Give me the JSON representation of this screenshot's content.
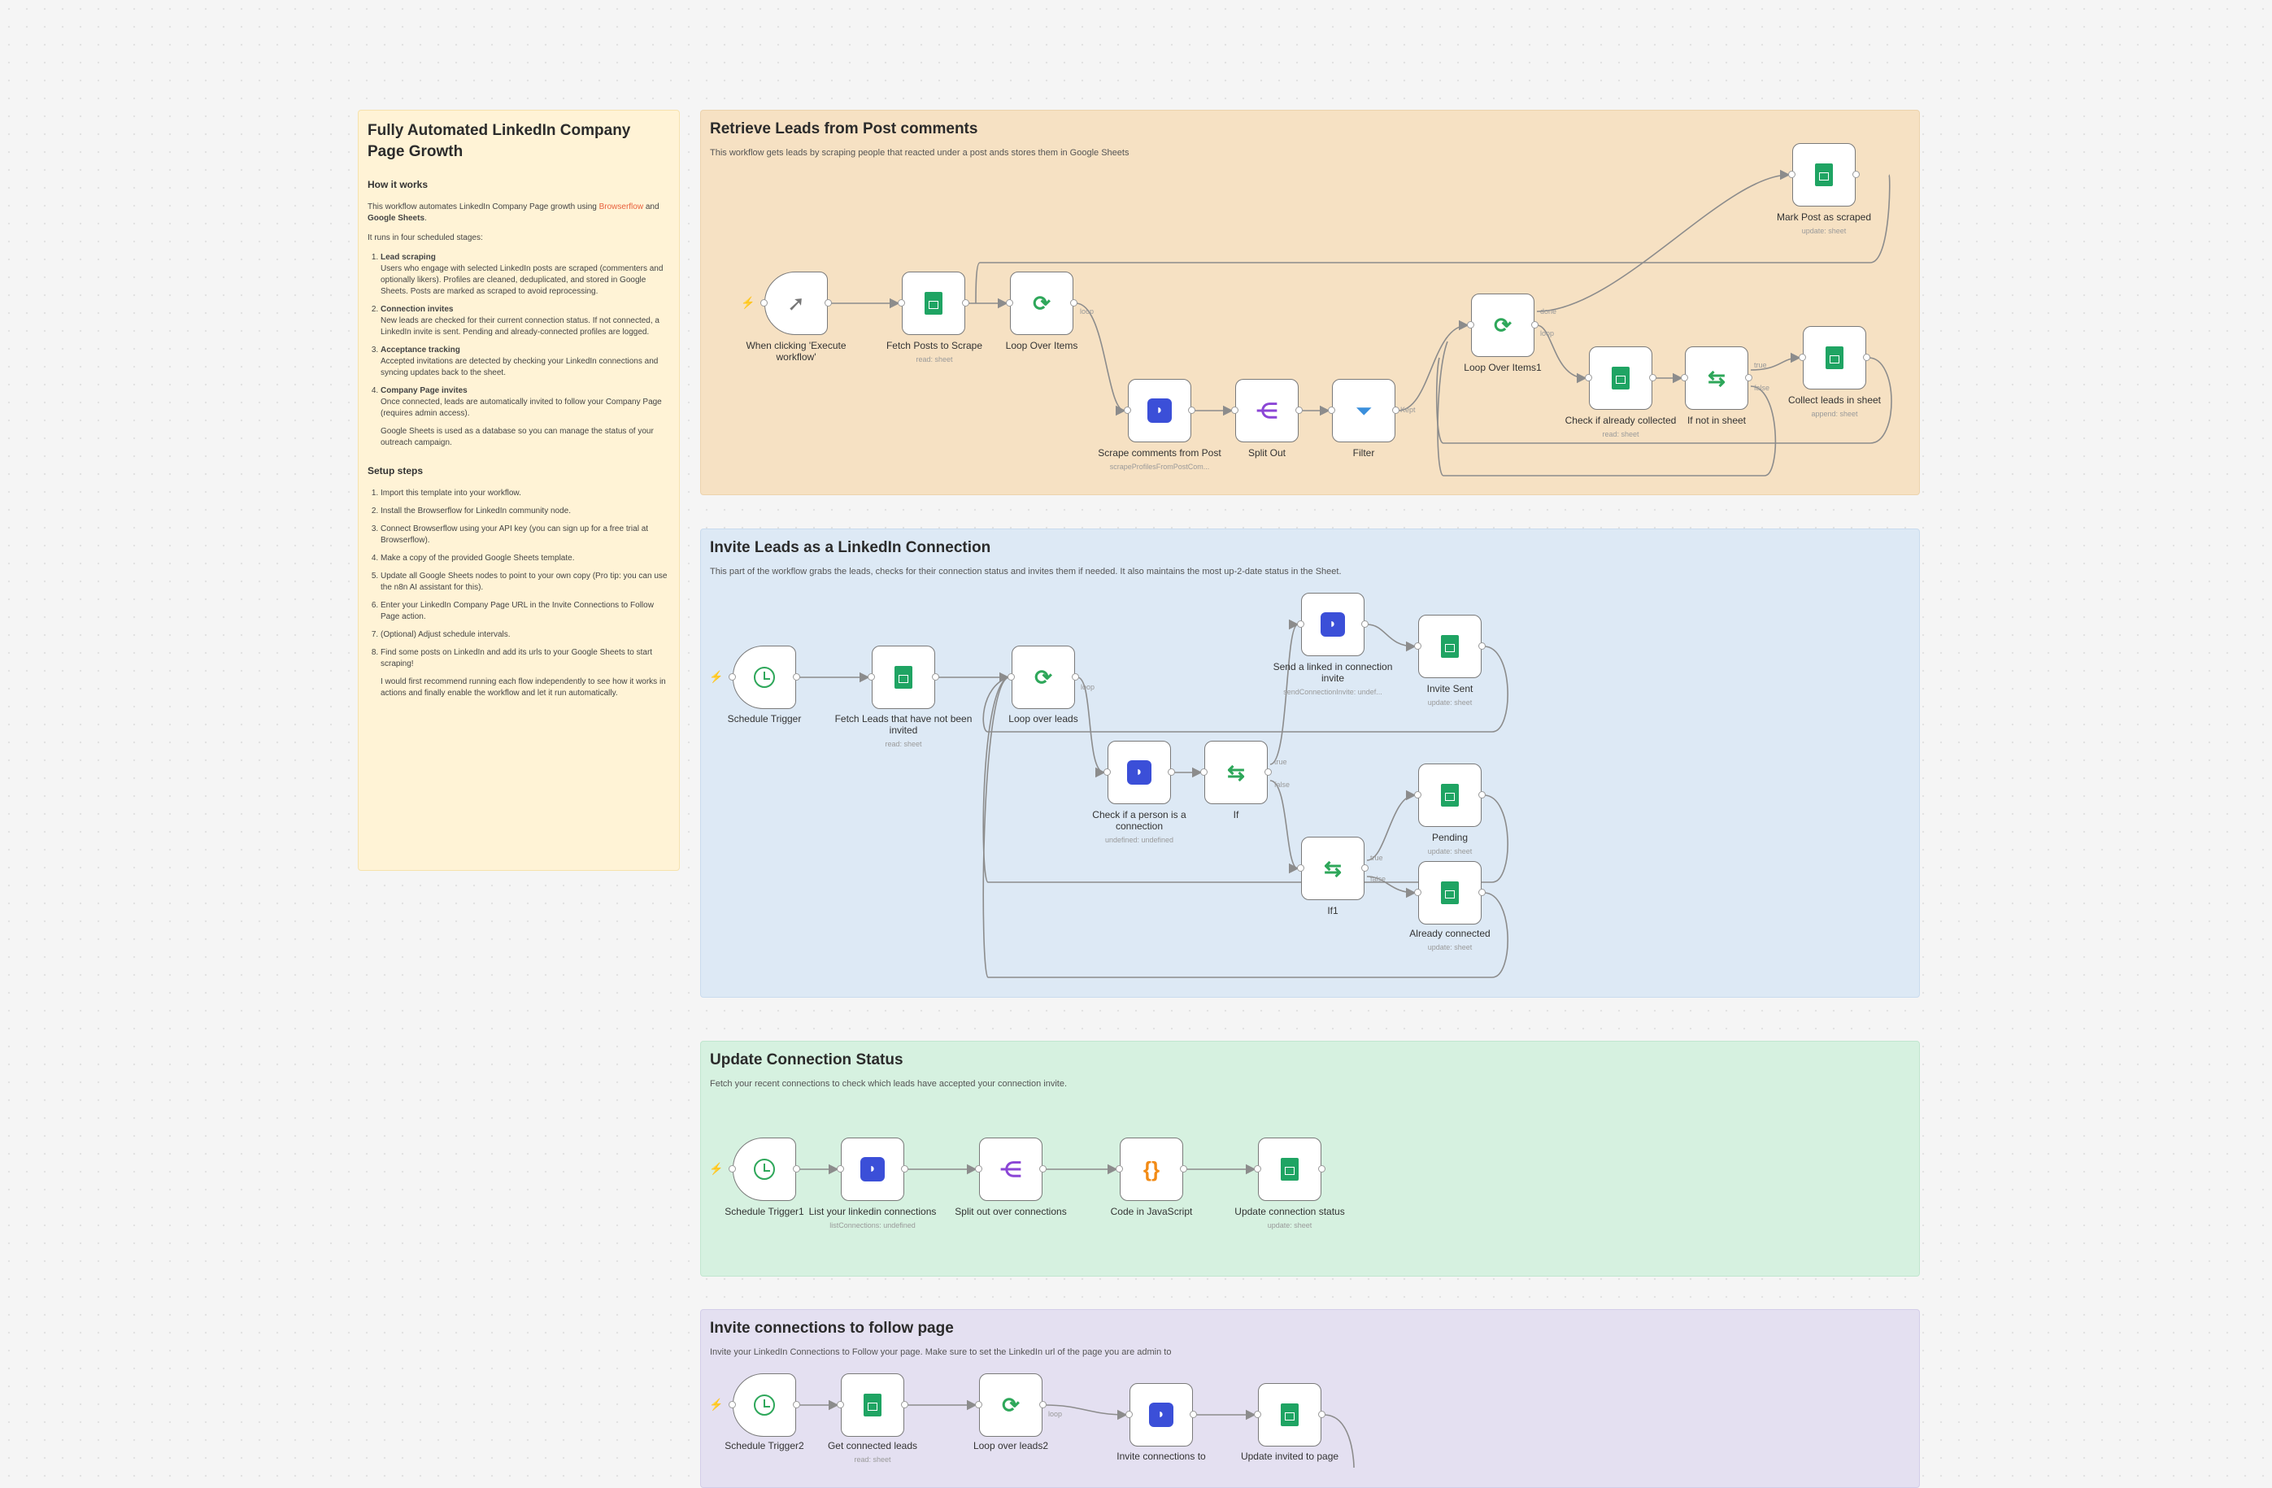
{
  "info": {
    "title": "Fully Automated LinkedIn Company Page Growth",
    "how_heading": "How it works",
    "intro_a": "This workflow automates LinkedIn Company Page growth using ",
    "intro_brand": "Browserflow",
    "intro_b": " and ",
    "intro_sheets": "Google Sheets",
    "intro_c": ".",
    "stages_intro": "It runs in four scheduled stages:",
    "stages": [
      {
        "title": "Lead scraping",
        "text": "Users who engage with selected LinkedIn posts are scraped (commenters and optionally likers). Profiles are cleaned, deduplicated, and stored in Google Sheets. Posts are marked as scraped to avoid reprocessing."
      },
      {
        "title": "Connection invites",
        "text": "New leads are checked for their current connection status. If not connected, a LinkedIn invite is sent. Pending and already-connected profiles are logged."
      },
      {
        "title": "Acceptance tracking",
        "text": "Accepted invitations are detected by checking your LinkedIn connections and syncing updates back to the sheet."
      },
      {
        "title": "Company Page invites",
        "text": "Once connected, leads are automatically invited to follow your Company Page (requires admin access)."
      }
    ],
    "db_note": "Google Sheets is used as a database so you can manage the status of your outreach campaign.",
    "setup_heading": "Setup steps",
    "setup": [
      "Import this template into your workflow.",
      "Install the Browserflow for LinkedIn community node.",
      "Connect Browserflow using your API key (you can sign up for a free trial at Browserflow).",
      "Make a copy of the provided Google Sheets template.",
      "Update all Google Sheets nodes to point to your own copy (Pro tip: you can use the n8n AI assistant for this).",
      "Enter your LinkedIn Company Page URL in the Invite Connections to Follow Page action.",
      "(Optional) Adjust schedule intervals.",
      "Find some posts on LinkedIn and add its urls to your Google Sheets to start scraping!"
    ],
    "final_note": "I would first recommend running each flow independently to see how it works in actions and finally enable the workflow and let it run automatically."
  },
  "sections": {
    "retrieve": {
      "title": "Retrieve Leads from Post comments",
      "sub": "This workflow gets leads by scraping people that reacted under a post ands stores them in Google Sheets"
    },
    "invite": {
      "title": "Invite Leads as a LinkedIn Connection",
      "sub": "This part of the workflow grabs the leads, checks for their connection status and invites them if needed. It also maintains the most up-2-date status in the Sheet."
    },
    "update": {
      "title": "Update Connection Status",
      "sub": "Fetch your recent connections to check which leads have accepted your connection invite."
    },
    "follow": {
      "title": "Invite connections to follow page",
      "sub": "Invite your LinkedIn Connections to Follow your page. Make sure to set the LinkedIn url of the page you are admin to"
    }
  },
  "nodes": {
    "manual": {
      "label": "When clicking 'Execute workflow'",
      "sub": "",
      "icon": "cursor-icon"
    },
    "fetch_posts": {
      "label": "Fetch Posts to Scrape",
      "sub": "read: sheet",
      "icon": "google-sheets-icon"
    },
    "loop_items": {
      "label": "Loop Over Items",
      "sub": "",
      "icon": "loop-icon"
    },
    "scrape_comments": {
      "label": "Scrape comments from Post",
      "sub": "scrapeProfilesFromPostCom...",
      "icon": "browserflow-icon"
    },
    "split_out": {
      "label": "Split Out",
      "sub": "",
      "icon": "split-icon"
    },
    "filter": {
      "label": "Filter",
      "sub": "",
      "icon": "filter-icon"
    },
    "loop_items1": {
      "label": "Loop Over Items1",
      "sub": "",
      "icon": "loop-icon"
    },
    "check_collected": {
      "label": "Check if already collected",
      "sub": "read: sheet",
      "icon": "google-sheets-icon"
    },
    "if_not_sheet": {
      "label": "If not in sheet",
      "sub": "",
      "icon": "if-icon"
    },
    "collect_leads": {
      "label": "Collect leads in sheet",
      "sub": "append: sheet",
      "icon": "google-sheets-icon"
    },
    "mark_scraped": {
      "label": "Mark Post as scraped",
      "sub": "update: sheet",
      "icon": "google-sheets-icon"
    },
    "schedule": {
      "label": "Schedule Trigger",
      "sub": "",
      "icon": "schedule-icon"
    },
    "fetch_leads": {
      "label": "Fetch Leads that have not been invited",
      "sub": "read: sheet",
      "icon": "google-sheets-icon"
    },
    "loop_leads": {
      "label": "Loop over leads",
      "sub": "",
      "icon": "loop-icon"
    },
    "check_connection": {
      "label": "Check if a person is a connection",
      "sub": "undefined: undefined",
      "icon": "browserflow-icon"
    },
    "if": {
      "label": "If",
      "sub": "",
      "icon": "if-icon"
    },
    "send_invite": {
      "label": "Send a linked in connection invite",
      "sub": "sendConnectionInvite: undef...",
      "icon": "browserflow-icon"
    },
    "invite_sent": {
      "label": "Invite Sent",
      "sub": "update: sheet",
      "icon": "google-sheets-icon"
    },
    "if1": {
      "label": "If1",
      "sub": "",
      "icon": "if-icon"
    },
    "pending": {
      "label": "Pending",
      "sub": "update: sheet",
      "icon": "google-sheets-icon"
    },
    "already_connected": {
      "label": "Already connected",
      "sub": "update: sheet",
      "icon": "google-sheets-icon"
    },
    "schedule1": {
      "label": "Schedule Trigger1",
      "sub": "",
      "icon": "schedule-icon"
    },
    "list_connections": {
      "label": "List your linkedin connections",
      "sub": "listConnections: undefined",
      "icon": "browserflow-icon"
    },
    "split_connections": {
      "label": "Split out over connections",
      "sub": "",
      "icon": "split-icon"
    },
    "code_js": {
      "label": "Code in JavaScript",
      "sub": "",
      "icon": "code-icon"
    },
    "update_status": {
      "label": "Update connection status",
      "sub": "update: sheet",
      "icon": "google-sheets-icon"
    },
    "schedule2": {
      "label": "Schedule Trigger2",
      "sub": "",
      "icon": "schedule-icon"
    },
    "get_connected": {
      "label": "Get connected leads",
      "sub": "read: sheet",
      "icon": "google-sheets-icon"
    },
    "loop_leads2": {
      "label": "Loop over leads2",
      "sub": "",
      "icon": "loop-icon"
    },
    "invite_follow": {
      "label": "Invite connections to",
      "sub": "",
      "icon": "browserflow-icon"
    },
    "update_invited": {
      "label": "Update invited to page",
      "sub": "",
      "icon": "google-sheets-icon"
    }
  },
  "edge_labels": {
    "loop": "loop",
    "done": "done",
    "kept": "Kept",
    "true": "true",
    "false": "false"
  }
}
